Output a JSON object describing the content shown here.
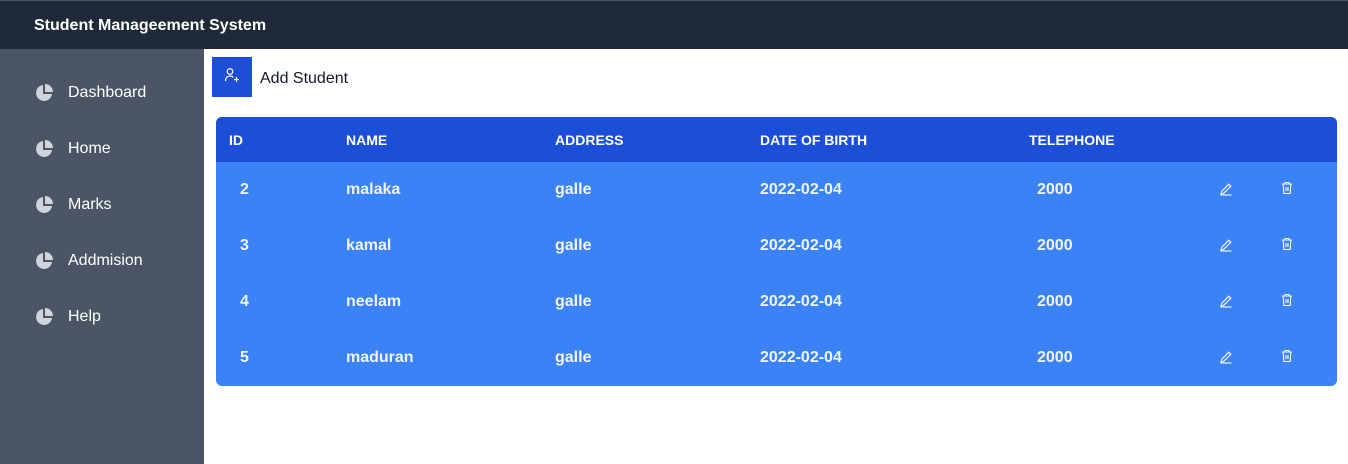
{
  "header": {
    "title": "Student Manageement System"
  },
  "sidebar": {
    "items": [
      {
        "label": "Dashboard",
        "icon": "pie-chart-icon"
      },
      {
        "label": "Home",
        "icon": "pie-chart-icon"
      },
      {
        "label": "Marks",
        "icon": "pie-chart-icon"
      },
      {
        "label": "Addmision",
        "icon": "pie-chart-icon"
      },
      {
        "label": "Help",
        "icon": "pie-chart-icon"
      }
    ]
  },
  "toolbar": {
    "add_label": "Add Student",
    "add_icon": "user-plus-icon"
  },
  "table": {
    "columns": [
      "ID",
      "NAME",
      "ADDRESS",
      "DATE OF BIRTH",
      "TELEPHONE"
    ],
    "rows": [
      {
        "id": "2",
        "name": "malaka",
        "address": "galle",
        "dob": "2022-02-04",
        "telephone": "2000"
      },
      {
        "id": "3",
        "name": "kamal",
        "address": "galle",
        "dob": "2022-02-04",
        "telephone": "2000"
      },
      {
        "id": "4",
        "name": "neelam",
        "address": "galle",
        "dob": "2022-02-04",
        "telephone": "2000"
      },
      {
        "id": "5",
        "name": "maduran",
        "address": "galle",
        "dob": "2022-02-04",
        "telephone": "2000"
      }
    ],
    "row_actions": [
      "edit-icon",
      "delete-icon"
    ]
  },
  "colors": {
    "topbar": "#1f2937",
    "sidebar": "#4b5563",
    "accent": "#1d4ed8",
    "table_body": "#3b82f6"
  }
}
